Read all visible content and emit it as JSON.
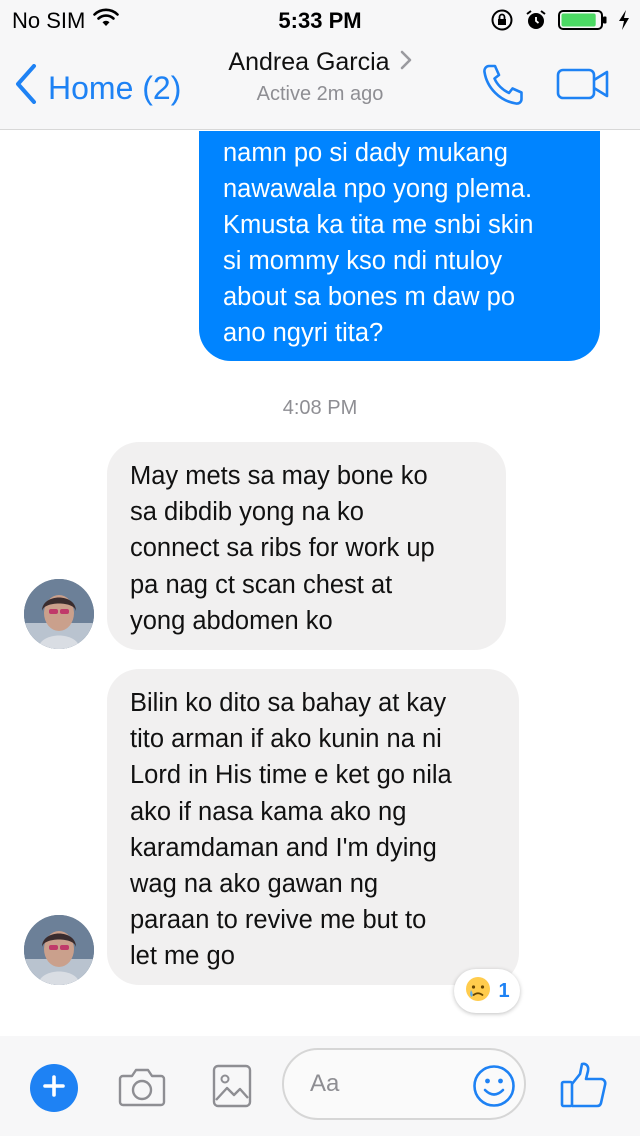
{
  "status_bar": {
    "carrier": "No SIM",
    "time": "5:33 PM",
    "icons": [
      "wifi-icon",
      "orientation-lock-icon",
      "alarm-icon",
      "battery-icon",
      "charging-bolt-icon"
    ],
    "battery_level": 0.9
  },
  "header": {
    "back_label": "Home (2)",
    "contact_name": "Andrea Garcia",
    "active_status": "Active 2m ago",
    "icons": [
      "chevron-left-icon",
      "chevron-right-icon",
      "phone-icon",
      "video-camera-icon"
    ],
    "accent_color": "#1e82f4"
  },
  "conversation": {
    "outgoing_message": {
      "lines": [
        "namn po si dady mukang",
        "nawawala npo yong plema.",
        "Kmusta ka tita me snbi skin",
        "si mommy kso ndi ntuloy",
        "about sa bones m daw po",
        "ano ngyri tita?"
      ],
      "color": "#0084ff"
    },
    "timestamp": "4:08 PM",
    "incoming_messages": [
      {
        "lines": [
          "May mets sa may bone ko",
          "sa dibdib yong na ko",
          "connect sa ribs for work up",
          "pa nag ct scan chest at",
          "yong abdomen ko"
        ]
      },
      {
        "lines": [
          "Bilin ko dito sa bahay at kay",
          "tito arman if ako kunin na ni",
          "Lord in His time e ket go nila",
          "ako if nasa kama ako ng",
          "karamdaman and I'm dying",
          "wag na ako gawan ng",
          "paraan to revive me but to",
          "let me go"
        ],
        "reaction": {
          "icon": "crying-face-icon",
          "count": "1"
        }
      }
    ]
  },
  "composer": {
    "placeholder": "Aa",
    "icons": [
      "plus-icon",
      "camera-icon",
      "gallery-icon",
      "emoji-icon",
      "thumbs-up-icon"
    ]
  }
}
